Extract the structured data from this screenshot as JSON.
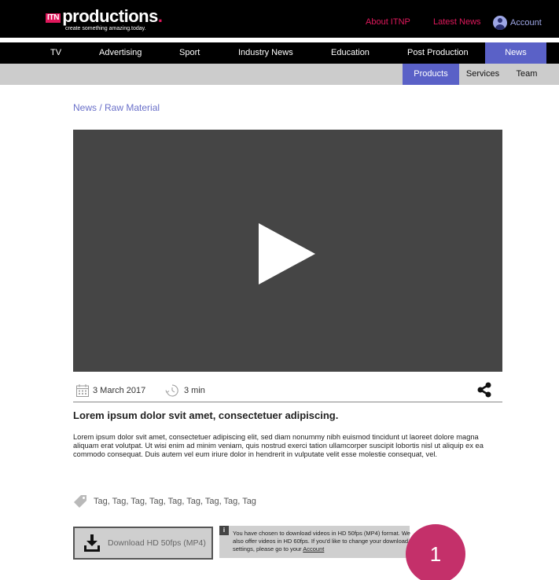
{
  "brand": {
    "mark": "ITN",
    "wordmark": "productions",
    "dot": ".",
    "tagline": "create something amazing.today."
  },
  "header": {
    "links": [
      {
        "label": "About ITNP"
      },
      {
        "label": "Latest News"
      }
    ],
    "account_label": "Account"
  },
  "nav": {
    "items": [
      {
        "label": "TV"
      },
      {
        "label": "Advertising"
      },
      {
        "label": "Sport"
      },
      {
        "label": "Industry News"
      },
      {
        "label": "Education"
      },
      {
        "label": "Post Production"
      },
      {
        "label": "News",
        "active": true
      }
    ]
  },
  "subnav": {
    "items": [
      {
        "label": "Products",
        "active": true
      },
      {
        "label": "Services"
      },
      {
        "label": "Team"
      }
    ]
  },
  "breadcrumb": "News / Raw Material",
  "video": {
    "icon": "play-icon"
  },
  "meta": {
    "date": "3 March 2017",
    "duration": "3 min"
  },
  "article": {
    "title": "Lorem ipsum dolor svit amet, consectetuer adipiscing.",
    "body": "Lorem ipsum dolor svit amet, consectetuer adipiscing elit, sed diam nonummy nibh euismod tincidunt ut laoreet dolore magna aliquam erat volutpat. Ut wisi enim ad minim veniam, quis nostrud exerci tation ullamcorper suscipit lobortis nisl ut aliquip ex ea commodo consequat. Duis autem vel eum iriure dolor in hendrerit in vulputate velit esse molestie consequat, vel.",
    "tags": "Tag, Tag, Tag, Tag, Tag, Tag, Tag, Tag, Tag"
  },
  "download": {
    "label": "Download HD 50fps (MP4)",
    "info_icon": "i",
    "info_text": "You have chosen to download videos in HD 50fps (MP4) format. We also offer videos in HD 60fps. If you'd like to change your download settings, please go to your ",
    "info_link": "Account"
  },
  "annotation": {
    "number": "1"
  },
  "colors": {
    "accent": "#5a61c7",
    "brand_pink": "#e0185c",
    "badge": "#c4306a",
    "video_bg": "#454545"
  }
}
